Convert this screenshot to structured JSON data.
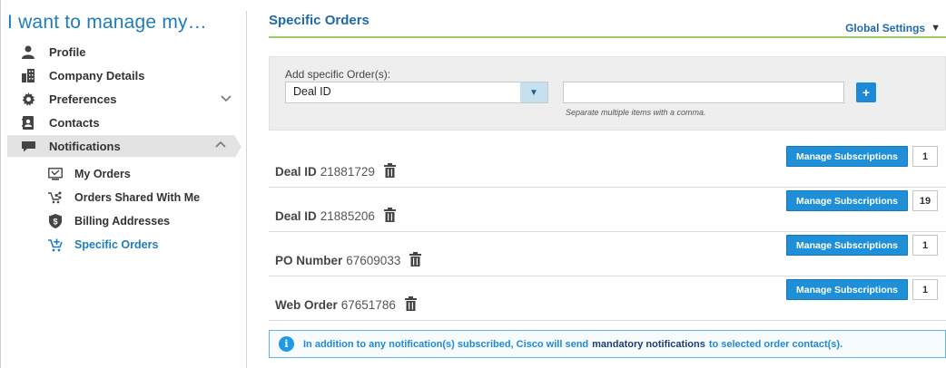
{
  "sidebar": {
    "title": "I want to manage my…",
    "items": [
      {
        "label": "Profile",
        "icon": "user-icon"
      },
      {
        "label": "Company Details",
        "icon": "building-icon"
      },
      {
        "label": "Preferences",
        "icon": "gear-icon",
        "expandable": true
      },
      {
        "label": "Contacts",
        "icon": "contacts-icon"
      },
      {
        "label": "Notifications",
        "icon": "chat-icon",
        "expanded": true
      }
    ],
    "sub_items": [
      {
        "label": "My Orders",
        "icon": "orders-icon"
      },
      {
        "label": "Orders Shared With Me",
        "icon": "shared-cart-icon"
      },
      {
        "label": "Billing Addresses",
        "icon": "dollar-shield-icon"
      },
      {
        "label": "Specific Orders",
        "icon": "cart-plus-icon",
        "active": true
      }
    ]
  },
  "main": {
    "title": "Specific Orders",
    "global_settings": "Global Settings",
    "filter": {
      "label": "Add specific Order(s):",
      "selected_type": "Deal ID",
      "input_value": "",
      "hint": "Separate multiple items with a comma.",
      "add_label": "+"
    },
    "orders": [
      {
        "type": "Deal ID",
        "number": "21881729",
        "button": "Manage Subscriptions",
        "count": "1"
      },
      {
        "type": "Deal ID",
        "number": "21885206",
        "button": "Manage Subscriptions",
        "count": "19"
      },
      {
        "type": "PO Number",
        "number": "67609033",
        "button": "Manage Subscriptions",
        "count": "1"
      },
      {
        "type": "Web Order",
        "number": "67651786",
        "button": "Manage Subscriptions",
        "count": "1"
      }
    ],
    "info": {
      "icon_text": "i",
      "part1": "In addition to any notification(s) subscribed, Cisco will send",
      "link": "mandatory notifications",
      "part2": "to selected order contact(s)."
    }
  },
  "colors": {
    "accent_blue": "#1e7db9",
    "button_blue": "#1f8fd8",
    "rule_green": "#8bc34a",
    "selected_bg": "#e3e3e3"
  }
}
